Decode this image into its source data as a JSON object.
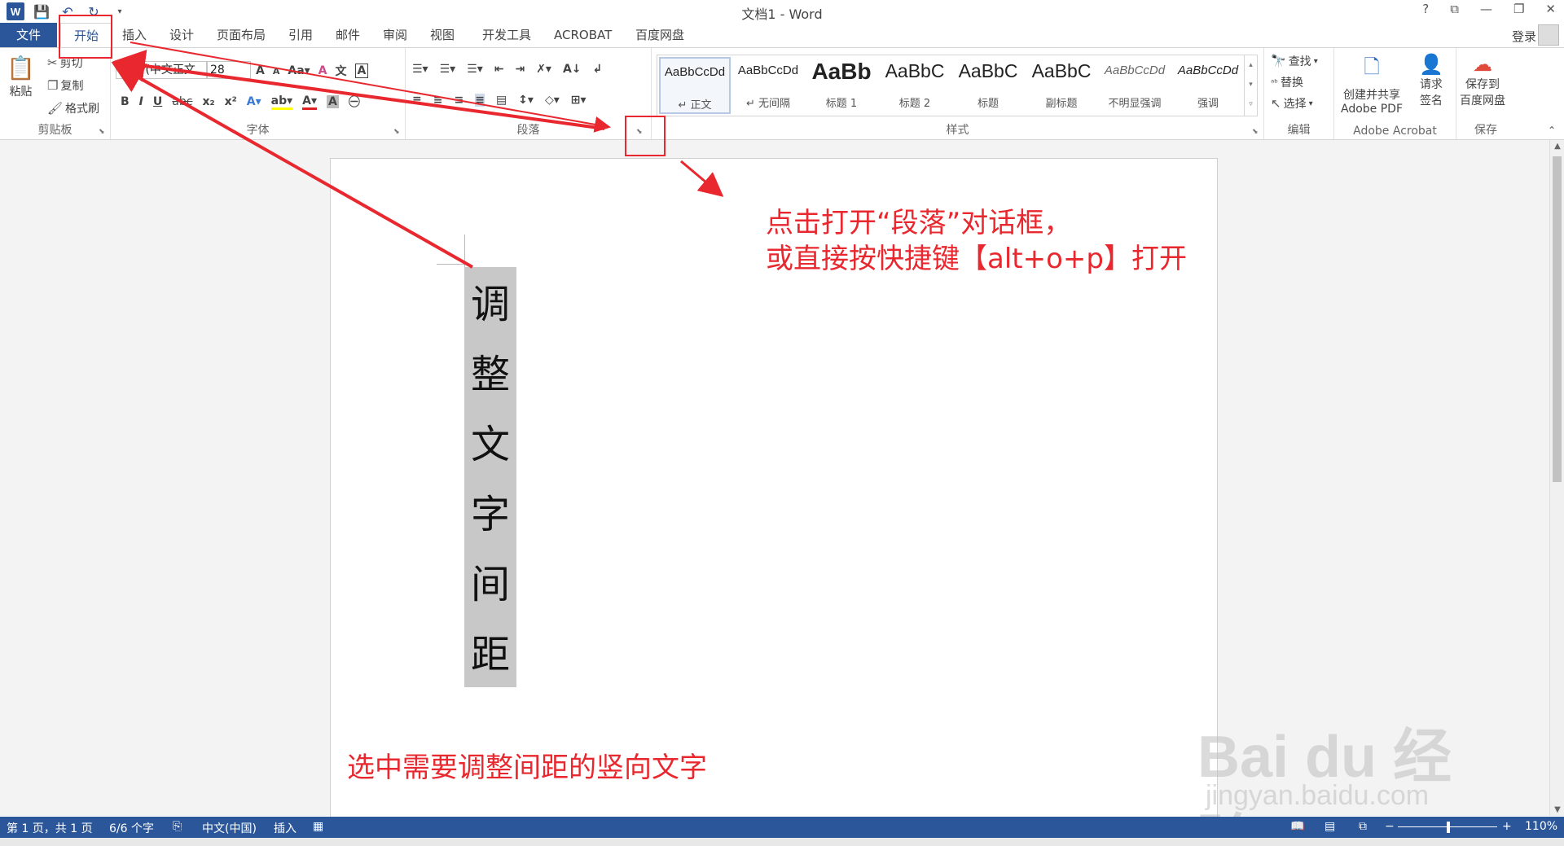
{
  "title": "文档1 - Word",
  "titlebar_controls": [
    "?",
    "⧉",
    "—",
    "❐",
    "✕"
  ],
  "tabs": [
    {
      "label": "文件"
    },
    {
      "label": "开始"
    },
    {
      "label": "插入"
    },
    {
      "label": "设计"
    },
    {
      "label": "页面布局"
    },
    {
      "label": "引用"
    },
    {
      "label": "邮件"
    },
    {
      "label": "审阅"
    },
    {
      "label": "视图"
    },
    {
      "label": "开发工具"
    },
    {
      "label": "ACROBAT"
    },
    {
      "label": "百度网盘"
    }
  ],
  "login": "登录",
  "clipboard": {
    "paste": "粘贴",
    "cut": "剪切",
    "copy": "复制",
    "format_painter": "格式刷",
    "label": "剪贴板"
  },
  "font": {
    "name": "宋体 (中文正文",
    "size": "28",
    "label": "字体"
  },
  "paragraph": {
    "label": "段落"
  },
  "styles": {
    "label": "样式",
    "items": [
      {
        "sample": "AaBbCcDd",
        "name": "↵ 正文"
      },
      {
        "sample": "AaBbCcDd",
        "name": "↵ 无间隔"
      },
      {
        "sample": "AaBb",
        "name": "标题 1"
      },
      {
        "sample": "AaBbC",
        "name": "标题 2"
      },
      {
        "sample": "AaBbC",
        "name": "标题"
      },
      {
        "sample": "AaBbC",
        "name": "副标题"
      },
      {
        "sample": "AaBbCcDd",
        "name": "不明显强调"
      },
      {
        "sample": "AaBbCcDd",
        "name": "强调"
      }
    ]
  },
  "editing": {
    "find": "查找",
    "replace": "替换",
    "select": "选择",
    "label": "编辑"
  },
  "acrobat": {
    "create_share": "创建并共享",
    "adobe_pdf": "Adobe PDF",
    "request": "请求",
    "sign": "签名",
    "label": "Adobe Acrobat"
  },
  "save_group": {
    "save_to": "保存到",
    "baidu": "百度网盘",
    "label": "保存"
  },
  "document": {
    "vertical_chars": [
      "调",
      "整",
      "文",
      "字",
      "间",
      "距"
    ]
  },
  "annotations": {
    "line1": "点击打开“段落”对话框，",
    "line2": "或直接按快捷键【alt+o+p】打开",
    "select_hint": "选中需要调整间距的竖向文字"
  },
  "status": {
    "page": "第 1 页，共 1 页",
    "words": "6/6 个字",
    "language": "中文(中国)",
    "mode": "插入",
    "zoom": "110%"
  },
  "watermark": {
    "main": "Bai  du 经验",
    "sub": "jingyan.baidu.com"
  },
  "colors": {
    "word_blue": "#2b579a",
    "annotation_red": "#e8282e",
    "selection_gray": "#c8c8c8"
  }
}
